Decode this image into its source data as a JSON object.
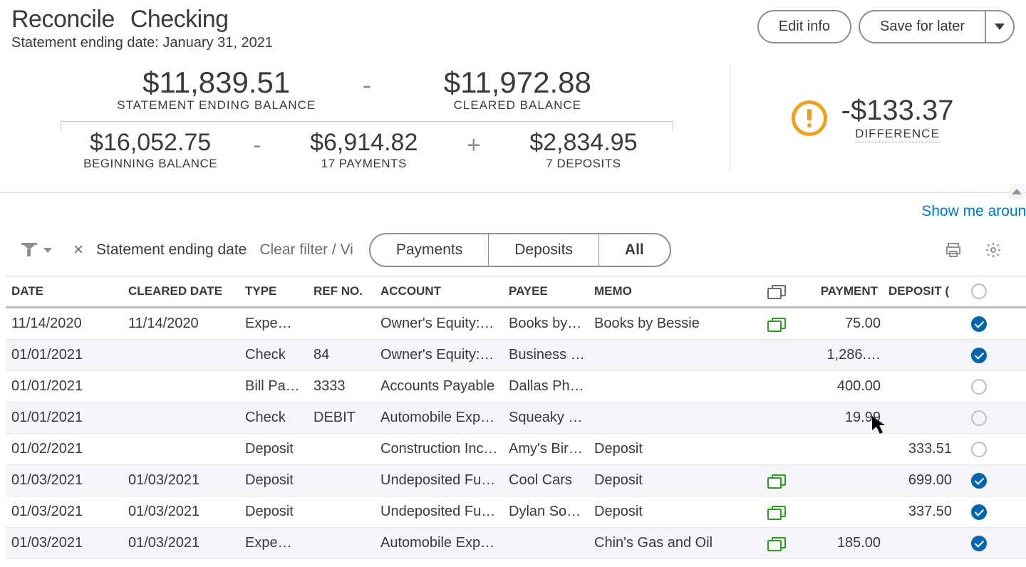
{
  "header": {
    "title_primary": "Reconcile",
    "title_secondary": "Checking",
    "subtitle": "Statement ending date: January 31, 2021",
    "edit_btn": "Edit info",
    "save_btn": "Save for later"
  },
  "summary": {
    "statement_balance": "$11,839.51",
    "statement_label": "STATEMENT ENDING BALANCE",
    "cleared_balance": "$11,972.88",
    "cleared_label": "CLEARED BALANCE",
    "beginning_balance": "$16,052.75",
    "beginning_label": "BEGINNING BALANCE",
    "payments_value": "$6,914.82",
    "payments_label": "17 PAYMENTS",
    "deposits_value": "$2,834.95",
    "deposits_label": "7 DEPOSITS",
    "difference_value": "-$133.37",
    "difference_label": "DIFFERENCE"
  },
  "toolbar": {
    "show_me": "Show me around",
    "filter_chip": "Statement ending date",
    "clear_filter": "Clear filter / Vi",
    "seg_payments": "Payments",
    "seg_deposits": "Deposits",
    "seg_all": "All"
  },
  "columns": {
    "date": "DATE",
    "cleared_date": "CLEARED DATE",
    "type": "TYPE",
    "ref": "REF NO.",
    "account": "ACCOUNT",
    "payee": "PAYEE",
    "memo": "MEMO",
    "payment": "PAYMENT",
    "deposit": "DEPOSIT ("
  },
  "rows": [
    {
      "date": "11/14/2020",
      "cleared": "11/14/2020",
      "type": "Expe…",
      "ref": "",
      "account": "Owner's Equity:…",
      "payee": "Books by…",
      "memo": "Books by Bessie",
      "attach": true,
      "payment": "75.00",
      "deposit": "",
      "checked": true
    },
    {
      "date": "01/01/2021",
      "cleared": "",
      "type": "Check",
      "ref": "84",
      "account": "Owner's Equity:…",
      "payee": "Business …",
      "memo": "",
      "attach": false,
      "payment": "1,286.…",
      "deposit": "",
      "checked": true
    },
    {
      "date": "01/01/2021",
      "cleared": "",
      "type": "Bill Pa…",
      "ref": "3333",
      "account": "Accounts Payable",
      "payee": "Dallas Ph…",
      "memo": "",
      "attach": false,
      "payment": "400.00",
      "deposit": "",
      "checked": false
    },
    {
      "date": "01/01/2021",
      "cleared": "",
      "type": "Check",
      "ref": "DEBIT",
      "account": "Automobile Exp…",
      "payee": "Squeaky …",
      "memo": "",
      "attach": false,
      "payment": "19.99",
      "deposit": "",
      "checked": false
    },
    {
      "date": "01/02/2021",
      "cleared": "",
      "type": "Deposit",
      "ref": "",
      "account": "Construction Inc…",
      "payee": "Amy's Bir…",
      "memo": "Deposit",
      "attach": false,
      "payment": "",
      "deposit": "333.51",
      "checked": false
    },
    {
      "date": "01/03/2021",
      "cleared": "01/03/2021",
      "type": "Deposit",
      "ref": "",
      "account": "Undeposited Fu…",
      "payee": "Cool Cars",
      "memo": "Deposit",
      "attach": true,
      "payment": "",
      "deposit": "699.00",
      "checked": true
    },
    {
      "date": "01/03/2021",
      "cleared": "01/03/2021",
      "type": "Deposit",
      "ref": "",
      "account": "Undeposited Fu…",
      "payee": "Dylan So…",
      "memo": "Deposit",
      "attach": true,
      "payment": "",
      "deposit": "337.50",
      "checked": true
    },
    {
      "date": "01/03/2021",
      "cleared": "01/03/2021",
      "type": "Expe…",
      "ref": "",
      "account": "Automobile Exp…",
      "payee": "",
      "memo": "Chin's Gas and Oil",
      "attach": true,
      "payment": "185.00",
      "deposit": "",
      "checked": true
    }
  ]
}
